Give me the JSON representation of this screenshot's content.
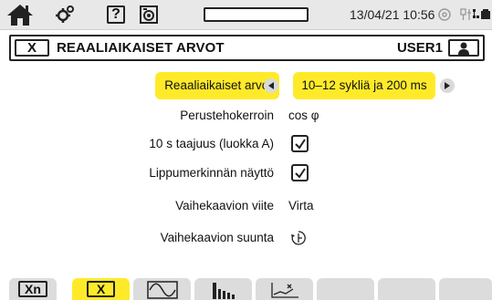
{
  "status_bar": {
    "icons": [
      "home-icon",
      "gears-icon",
      "help-icon",
      "camera-icon",
      "progress-bar",
      "disc-icon",
      "usb-network-icon",
      "battery-icon"
    ],
    "help_label": "?",
    "progress_fraction": 0.0,
    "datetime": "13/04/21 10:56"
  },
  "title_bar": {
    "close_label": "X",
    "title": "REAALIAIKAISET ARVOT",
    "user": "USER1",
    "user_icon": "user-icon"
  },
  "settings": {
    "rows": [
      {
        "label": "Reaaliaikaiset arvot",
        "value": "10–12 sykliä ja 200 ms",
        "type": "selector"
      },
      {
        "label": "Perustehokerroin",
        "value": "cos φ",
        "type": "text"
      },
      {
        "label": "10 s taajuus (luokka A)",
        "value": true,
        "type": "checkbox"
      },
      {
        "label": "Lippumerkinnän näyttö",
        "value": true,
        "type": "checkbox"
      },
      {
        "label": "Vaihekaavion viite",
        "value": "Virta",
        "type": "text"
      },
      {
        "label": "Vaihekaavion suunta",
        "value": "rotation-direction-icon",
        "type": "icon"
      }
    ]
  },
  "bottom_tabs": [
    {
      "label": "Xn",
      "icon": "",
      "selected": false
    },
    {
      "label": "X",
      "icon": "",
      "selected": true
    },
    {
      "label": "",
      "icon": "waveform-icon",
      "selected": false
    },
    {
      "label": "",
      "icon": "harmonics-bars-icon",
      "selected": false
    },
    {
      "label": "",
      "icon": "trend-chart-icon",
      "selected": false
    },
    {
      "label": "",
      "icon": "",
      "selected": false
    },
    {
      "label": "",
      "icon": "",
      "selected": false
    },
    {
      "label": "",
      "icon": "",
      "selected": false
    }
  ],
  "colors": {
    "highlight": "#ffea2a",
    "status_bar_bg": "#e8e8e8",
    "tab_bg": "#dcdcdc",
    "text": "#111111"
  }
}
